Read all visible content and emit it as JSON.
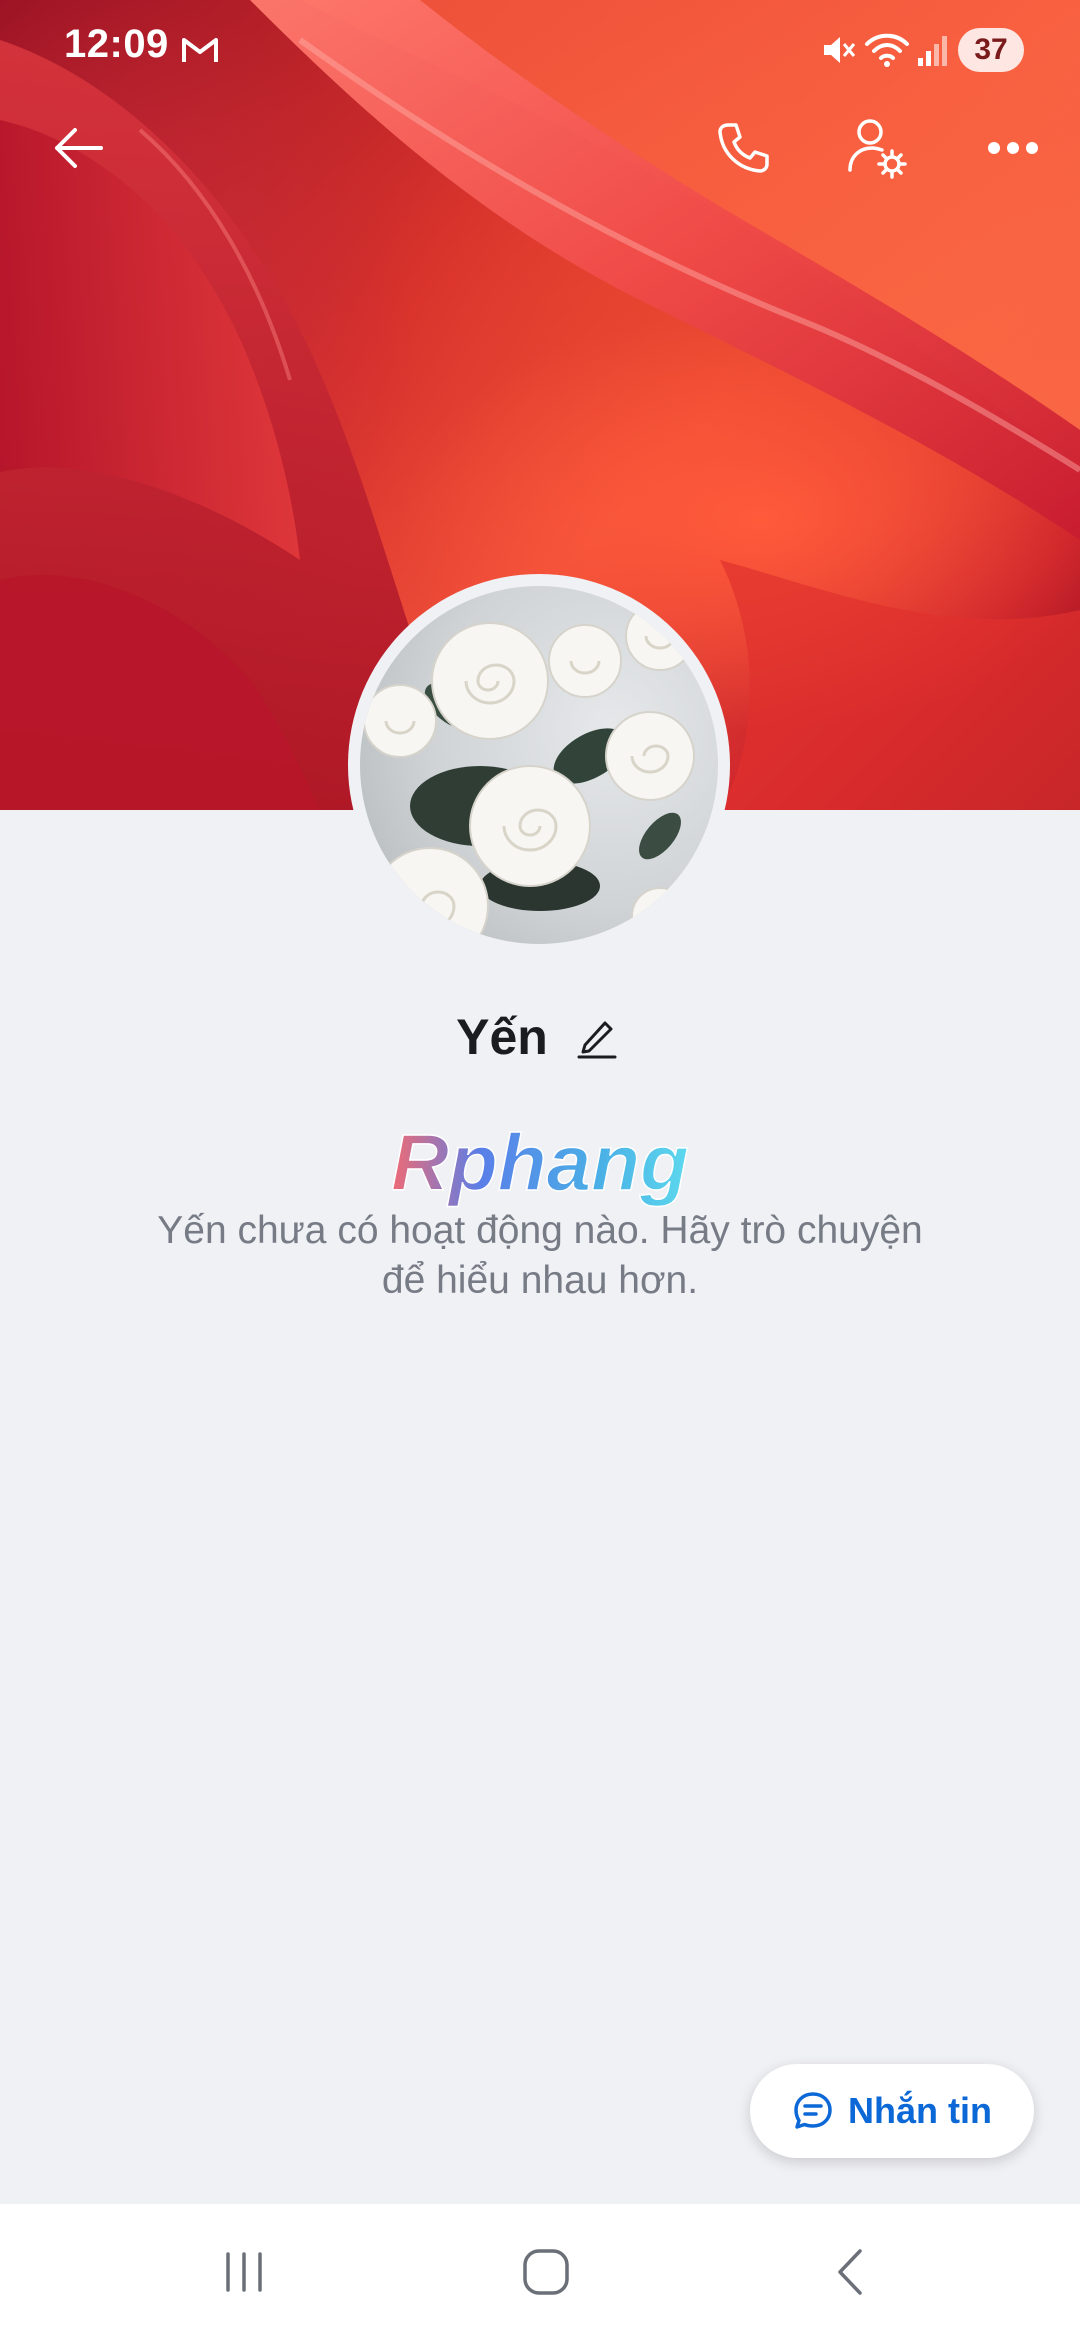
{
  "status_bar": {
    "time": "12:09",
    "battery": "37",
    "icons": [
      "gmail-icon",
      "mute-icon",
      "wifi-icon",
      "signal-icon"
    ]
  },
  "top_bar": {
    "back_icon": "arrow-left-icon",
    "call_icon": "phone-icon",
    "settings_icon": "user-settings-icon",
    "more_icon": "more-horizontal-icon"
  },
  "profile": {
    "name": "Yến",
    "edit_icon": "pencil-icon"
  },
  "watermark": {
    "text": "Rphang"
  },
  "empty_state": {
    "line1": "Yến chưa có hoạt động nào. Hãy trò chuyện",
    "line2": "để hiểu nhau hơn."
  },
  "message_button": {
    "label": "Nhắn tin",
    "icon": "chat-bubble-icon"
  },
  "nav_bar": {
    "items": [
      "recents-icon",
      "home-icon",
      "back-icon"
    ]
  },
  "colors": {
    "accent": "#0b68d6",
    "background": "#f0f1f5",
    "cover_red": "#d8322c",
    "muted_text": "#767b85"
  }
}
